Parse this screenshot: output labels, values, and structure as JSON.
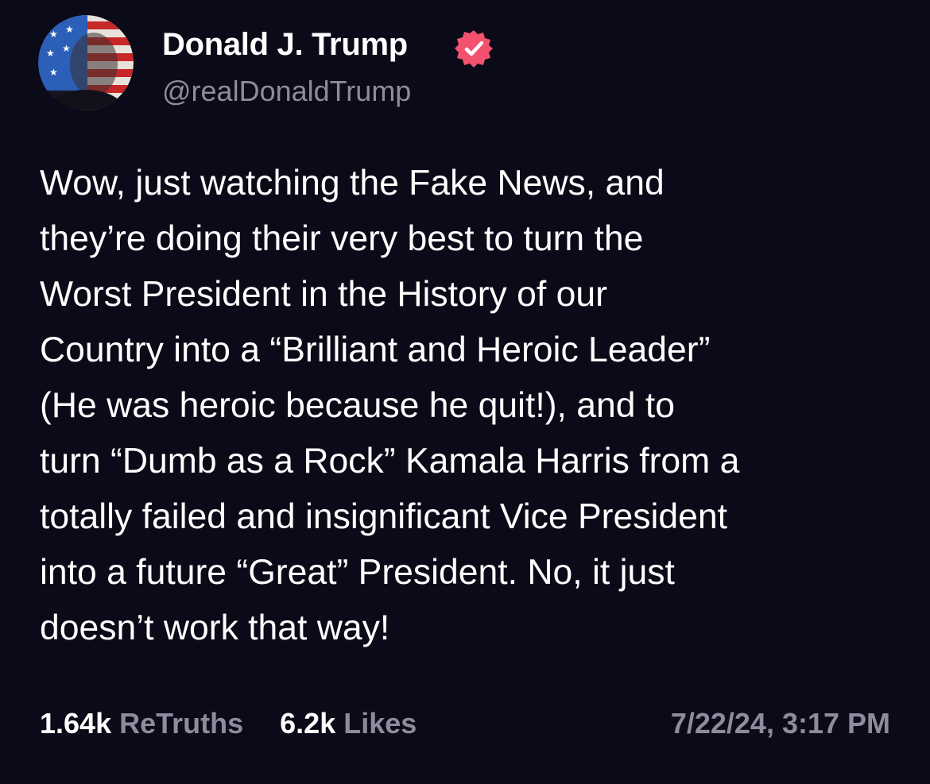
{
  "author": {
    "display_name": "Donald J. Trump",
    "handle": "@realDonaldTrump",
    "verified_icon": "verified-badge-icon",
    "avatar_icon": "flag-portrait-avatar"
  },
  "post": {
    "lines": [
      "Wow, just watching the Fake News, and",
      "they’re doing their very best to turn the",
      "Worst President in the History of our",
      "Country into a “Brilliant and Heroic Leader”",
      "(He was heroic because he quit!), and to",
      "turn “Dumb as a Rock” Kamala Harris from a",
      "totally failed and insignificant Vice President",
      "into a future “Great” President. No, it just",
      "doesn’t work that way!"
    ]
  },
  "stats": {
    "retruths_count": "1.64k",
    "retruths_label": "ReTruths",
    "likes_count": "6.2k",
    "likes_label": "Likes"
  },
  "timestamp": "7/22/24, 3:17 PM",
  "colors": {
    "background": "#0b0a18",
    "text_primary": "#ffffff",
    "text_secondary": "#8d8c9c",
    "verified_badge": "#f2526e"
  }
}
